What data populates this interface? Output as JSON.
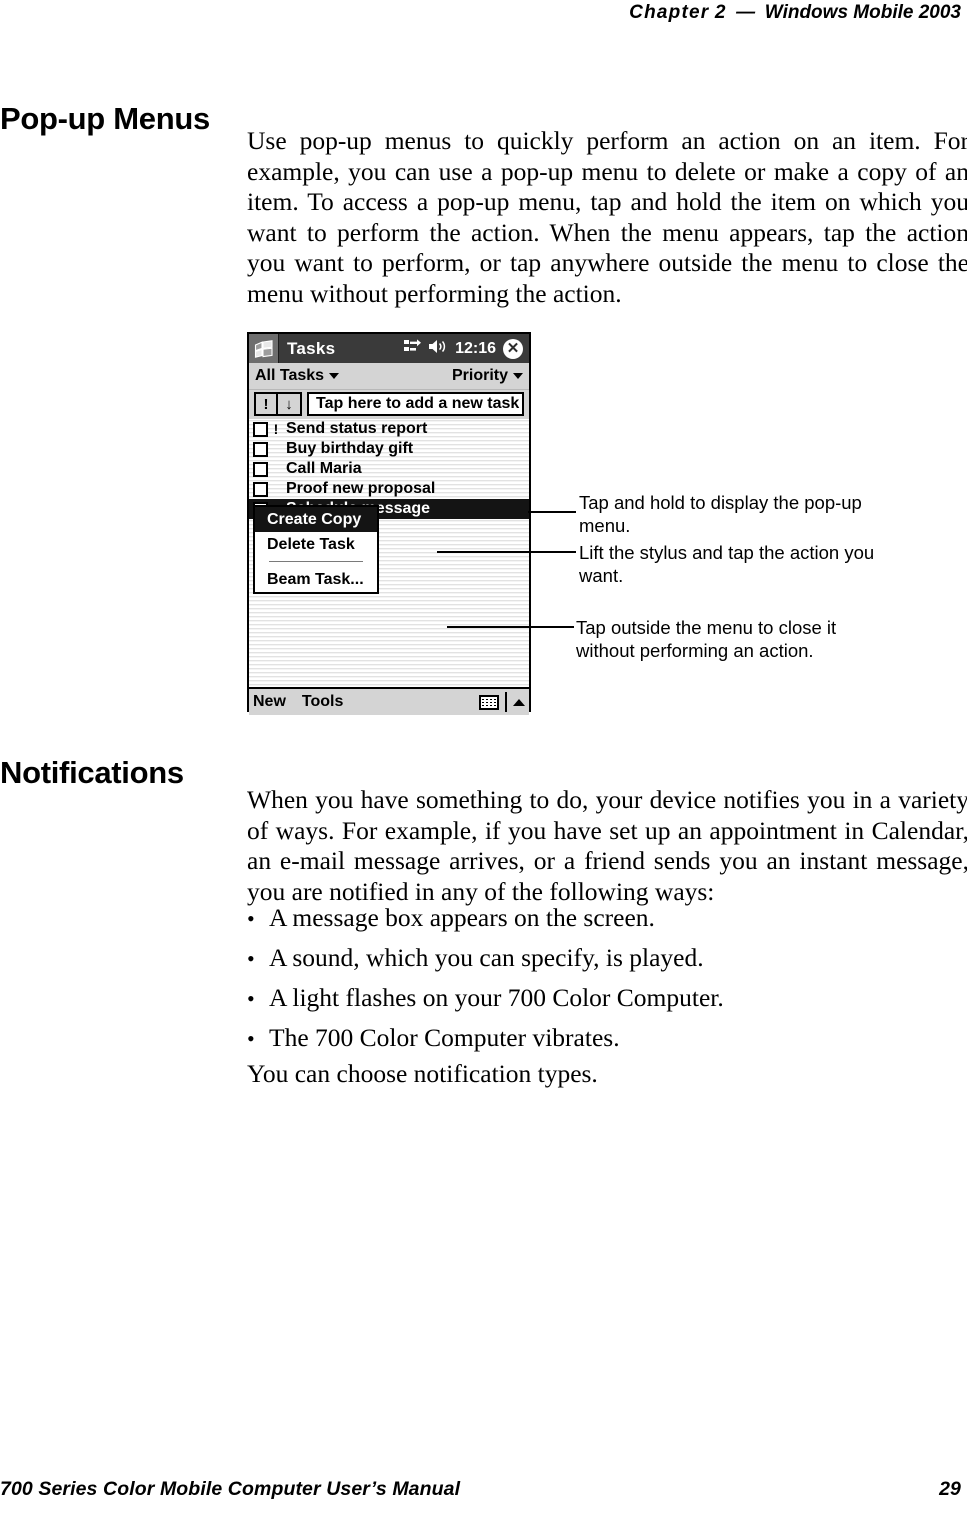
{
  "running_head": {
    "chapter_label": "Chapter",
    "chapter_number": "2",
    "dash": "—",
    "title": "Windows Mobile 2003"
  },
  "sections": {
    "popup_menus": {
      "heading": "Pop-up Menus",
      "paragraph": "Use pop-up menus to quickly perform an action on an item. For example, you can use a pop-up menu to delete or make a copy of an item. To access a pop-up menu, tap and hold the item on which you want to perform the action. When the menu appears, tap the action you want to perform, or tap anywhere outside the menu to close the menu without performing the action."
    },
    "notifications": {
      "heading": "Notifications",
      "paragraph": "When you have something to do, your device notifies you in a variety of ways. For example, if you have set up an appointment in Calendar, an e-mail message arrives, or a friend sends you an instant message, you are notified in any of the following ways:",
      "bullet_mark": "•",
      "bullets": [
        "A message box appears on the screen.",
        "A sound, which you can specify, is played.",
        "A light flashes on your 700 Color Computer.",
        "The 700 Color Computer vibrates."
      ],
      "closing": "You can choose notification types."
    }
  },
  "figure": {
    "device_screenshot": {
      "titlebar": {
        "app_name": "Tasks",
        "clock": "12:16",
        "close_label": "✕",
        "icons": [
          "windows-flag-icon",
          "connectivity-icon",
          "volume-icon",
          "close-icon"
        ]
      },
      "filterbar": {
        "filter_label": "All Tasks",
        "sort_label": "Priority"
      },
      "entry_row": {
        "priority_button": "!",
        "sort_button": "↓",
        "new_task_placeholder": "Tap here to add a new task"
      },
      "tasks": [
        {
          "label": "Send status report",
          "icon": "!",
          "selected": false
        },
        {
          "label": "Buy birthday gift",
          "icon": "",
          "selected": false
        },
        {
          "label": "Call Maria",
          "icon": "",
          "selected": false
        },
        {
          "label": "Proof new proposal",
          "icon": "",
          "selected": false
        },
        {
          "label": "Schedule message",
          "icon": "♪",
          "selected": true
        }
      ],
      "popup_menu": {
        "items": [
          {
            "label": "Create Copy",
            "highlighted": true
          },
          {
            "label": "Delete Task",
            "highlighted": false
          },
          {
            "label": "Beam Task...",
            "highlighted": false
          }
        ]
      },
      "command_bar": {
        "new_label": "New",
        "tools_label": "Tools",
        "input_panel_icon": "keyboard-icon"
      }
    },
    "callouts": [
      "Tap and hold to display the pop-up menu.",
      "Lift the stylus and tap the action you want.",
      "Tap outside the menu to close it without performing an action."
    ]
  },
  "footer": {
    "manual_title": "700 Series Color Mobile Computer User’s Manual",
    "page_number": "29"
  }
}
